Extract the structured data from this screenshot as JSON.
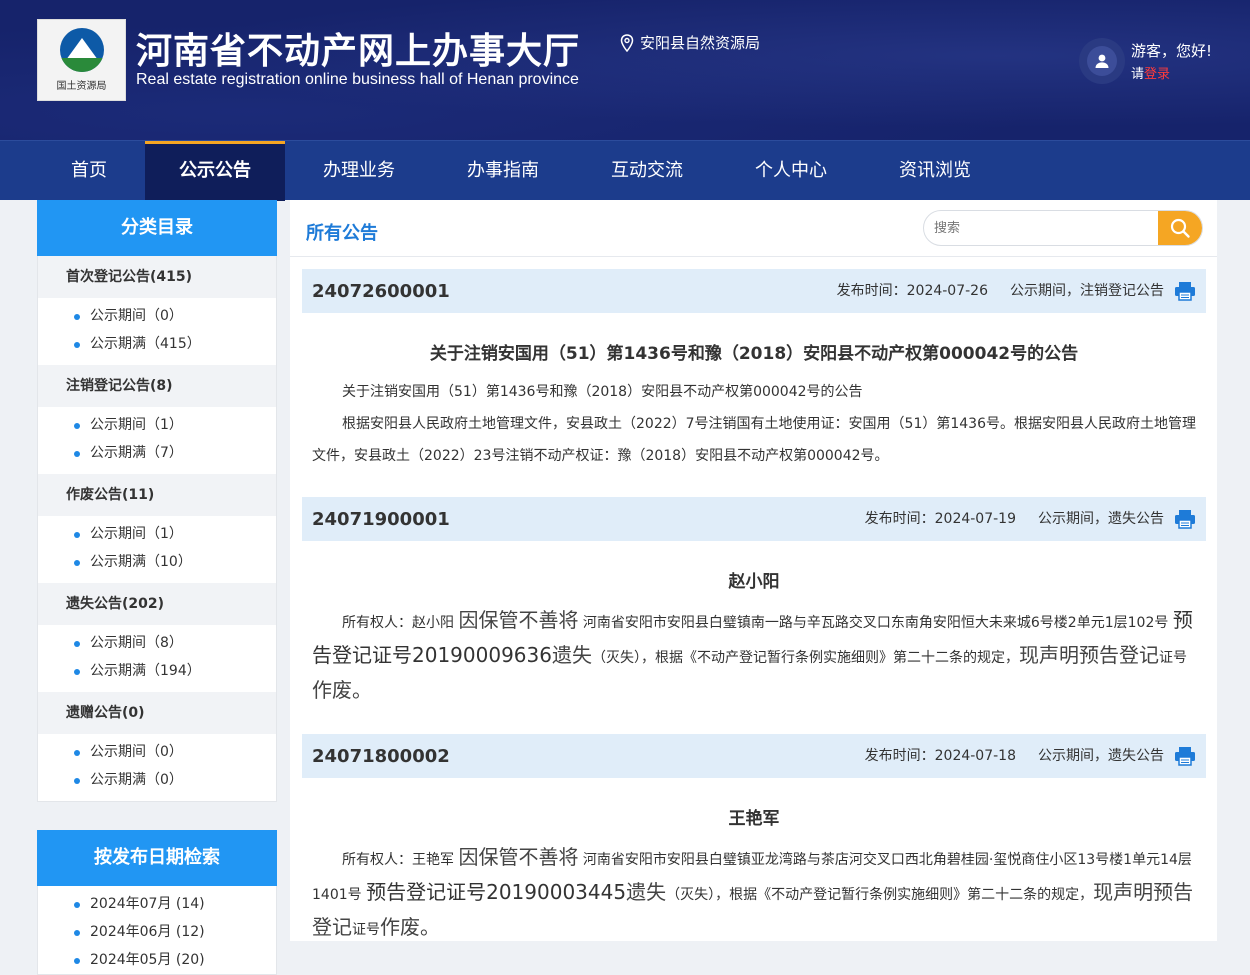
{
  "header": {
    "logo_text": "国土资源局",
    "title": "河南省不动产网上办事大厅",
    "subtitle": "Real estate registration online business hall of Henan province",
    "location": "安阳县自然资源局",
    "greeting": "游客，您好!",
    "login_prefix": "请",
    "login_link": "登录"
  },
  "nav": {
    "items": [
      "首页",
      "公示公告",
      "办理业务",
      "办事指南",
      "互动交流",
      "个人中心",
      "资讯浏览"
    ],
    "active": "公示公告"
  },
  "sidebar": {
    "heading": "分类目录",
    "categories": [
      {
        "label": "首次登记公告(415)",
        "subs": [
          "公示期间（0）",
          "公示期满（415）"
        ]
      },
      {
        "label": "注销登记公告(8)",
        "subs": [
          "公示期间（1）",
          "公示期满（7）"
        ]
      },
      {
        "label": "作废公告(11)",
        "subs": [
          "公示期间（1）",
          "公示期满（10）"
        ]
      },
      {
        "label": "遗失公告(202)",
        "subs": [
          "公示期间（8）",
          "公示期满（194）"
        ]
      },
      {
        "label": "遗赠公告(0)",
        "subs": [
          "公示期间（0）",
          "公示期满（0）"
        ]
      }
    ],
    "date_heading": "按发布日期检索",
    "dates": [
      "2024年07月 (14)",
      "2024年06月 (12)",
      "2024年05月 (20)"
    ]
  },
  "main": {
    "title": "所有公告",
    "search_placeholder": "搜索"
  },
  "announcements": [
    {
      "number": "24072600001",
      "date": "发布时间：2024-07-26",
      "status": "公示期间，注销登记公告",
      "title": "关于注销安国用（51）第1436号和豫（2018）安阳县不动产权第000042号的公告",
      "line1": "关于注销安国用（51）第1436号和豫（2018）安阳县不动产权第000042号的公告",
      "line2": "根据安阳县人民政府土地管理文件，安县政土（2022）7号注销国有土地使用证：安国用（51）第1436号。根据安阳县人民政府土地管理文件，安县政土（2022）23号注销不动产权证：豫（2018）安阳县不动产权第000042号。"
    },
    {
      "number": "24071900001",
      "date": "发布时间：2024-07-19",
      "status": "公示期间，遗失公告",
      "title": "赵小阳",
      "owner": "所有权人：赵小阳",
      "reason": "因保管不善将",
      "address": "河南省安阳市安阳县白璧镇南一路与辛瓦路交叉口东南角安阳恒大未来城6号楼2单元1层102号",
      "cert": "预告登记证号20190009636",
      "lost1": "遗失",
      "lost2": "（灭失），根据《不动产登记暂行条例实施细则》第二十二条的规定，",
      "decl1": "现声明预告登记",
      "decl2": "证号",
      "decl3": "作废。"
    },
    {
      "number": "24071800002",
      "date": "发布时间：2024-07-18",
      "status": "公示期间，遗失公告",
      "title": "王艳军",
      "owner": "所有权人：王艳军",
      "reason": "因保管不善将",
      "address": "河南省安阳市安阳县白璧镇亚龙湾路与茶店河交叉口西北角碧桂园·玺悦商住小区13号楼1单元14层1401号",
      "cert": "预告登记证号20190003445",
      "lost1": "遗失",
      "lost2": "（灭失），根据《不动产登记暂行条例实施细则》第二十二条的规定，",
      "decl1": "现声明预告登记",
      "decl2": "证号",
      "decl3": "作废。"
    }
  ]
}
